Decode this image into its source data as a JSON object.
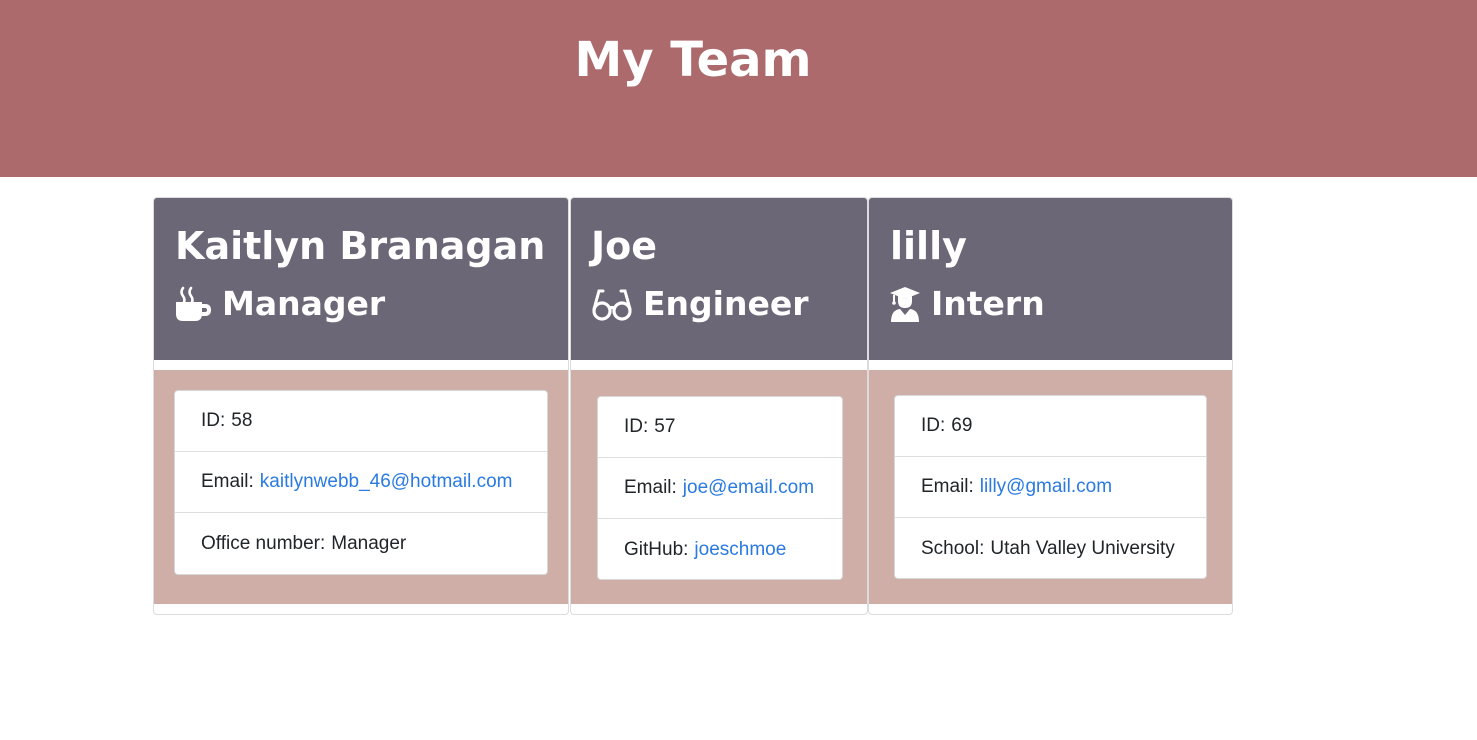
{
  "header": {
    "title": "My Team"
  },
  "colors": {
    "hero": "#ac6a6c",
    "card_header": "#6c6776",
    "card_body": "#d0aea8",
    "link": "#2a7ae2"
  },
  "team": [
    {
      "name": "Kaitlyn Branagan",
      "role": "Manager",
      "role_icon": "coffee-mug-icon",
      "id_label": "ID:",
      "id": "58",
      "email_label": "Email:",
      "email": "kaitlynwebb_46@hotmail.com",
      "extra_label": "Office number:",
      "extra_value": "Manager"
    },
    {
      "name": "Joe",
      "role": "Engineer",
      "role_icon": "glasses-icon",
      "id_label": "ID:",
      "id": "57",
      "email_label": "Email:",
      "email": "joe@email.com",
      "extra_label": "GitHub:",
      "extra_value": "joeschmoe"
    },
    {
      "name": "lilly",
      "role": "Intern",
      "role_icon": "graduate-icon",
      "id_label": "ID:",
      "id": "69",
      "email_label": "Email:",
      "email": "lilly@gmail.com",
      "extra_label": "School:",
      "extra_value": "Utah Valley University"
    }
  ]
}
